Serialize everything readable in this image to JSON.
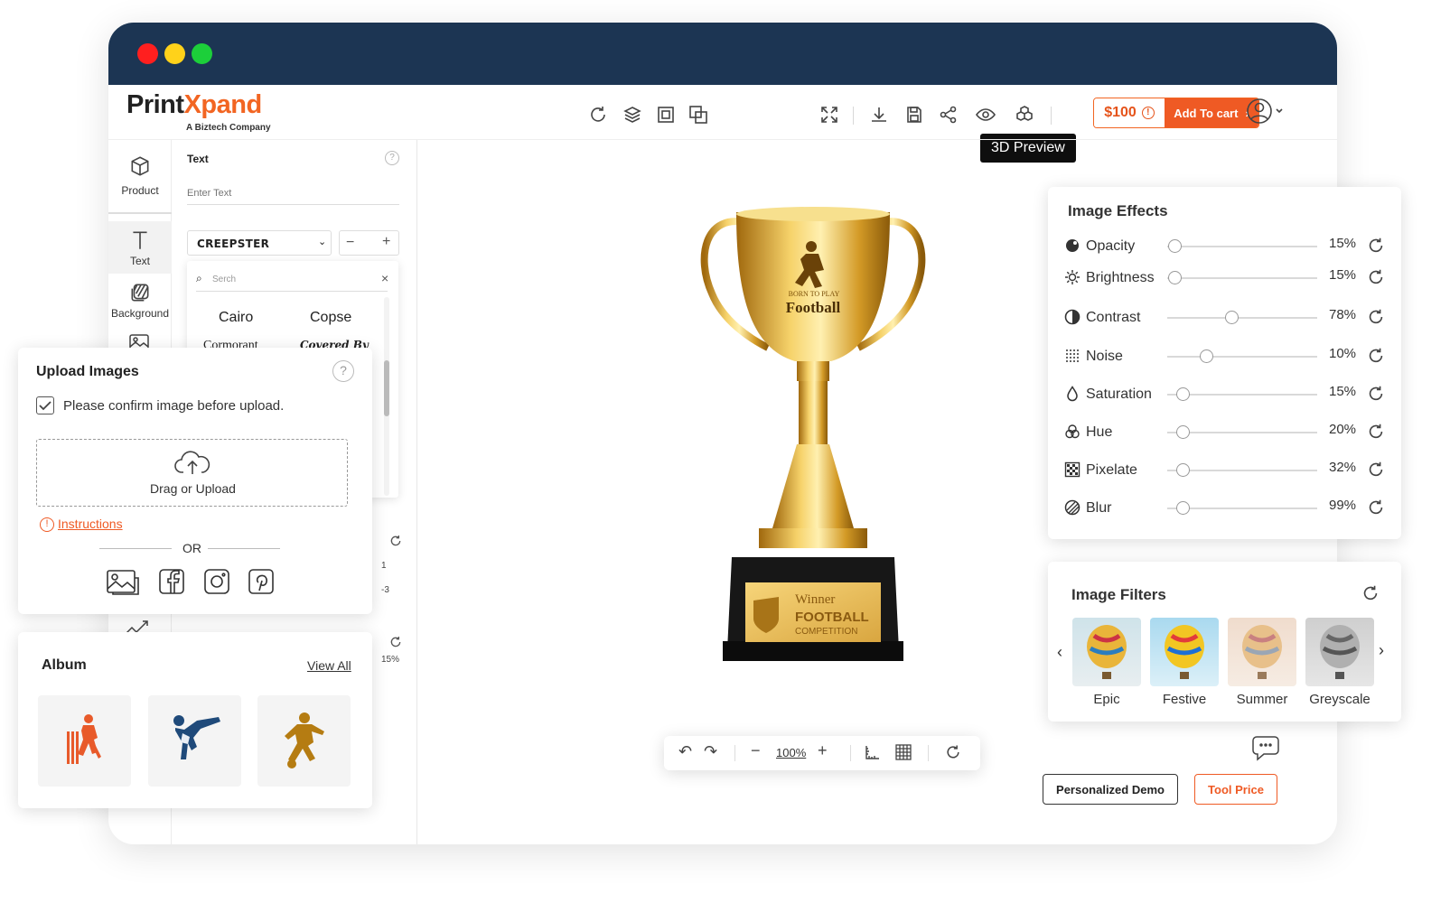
{
  "app": {
    "brand_prefix": "Print",
    "brand_x": "X",
    "brand_suffix": "pand",
    "brand_sub": "A Biztech Company"
  },
  "colors": {
    "titlebar": "#1c3553",
    "accent": "#ef5a24",
    "dot_red": "#ff1f1f",
    "dot_yellow": "#ffd21a",
    "dot_green": "#1ccf3a"
  },
  "toolbar": {
    "price": "$100",
    "add_to_cart": "Add To cart",
    "tooltip": "3D Preview",
    "icons": [
      "refresh-icon",
      "layers-icon",
      "group-icon",
      "ungroup-icon",
      "fullscreen-icon",
      "download-icon",
      "save-icon",
      "share-icon",
      "preview-eye-icon",
      "3d-preview-icon",
      "user-icon"
    ]
  },
  "rail": {
    "items": [
      {
        "label": "Product",
        "icon": "cube-icon"
      },
      {
        "label": "Text",
        "icon": "text-icon"
      },
      {
        "label": "Background",
        "icon": "background-icon"
      }
    ]
  },
  "text_panel": {
    "title": "Text",
    "placeholder": "Enter Text",
    "font_selected": "CREEPSTER",
    "search_placeholder": "Serch",
    "fonts": [
      "Cairo",
      "Copse",
      "Cormorant",
      "Covered By"
    ],
    "partial_values": [
      "1",
      "-3",
      "15%"
    ]
  },
  "upload": {
    "title": "Upload Images",
    "confirm_label": "Please confirm image before upload.",
    "drop_label": "Drag or Upload",
    "instructions": "Instructions",
    "or_label": "OR",
    "sources": [
      "gallery-icon",
      "facebook-icon",
      "instagram-icon",
      "pinterest-icon"
    ]
  },
  "album": {
    "title": "Album",
    "view_all": "View All",
    "items": [
      "cricket-player-icon",
      "karate-icon",
      "football-player-icon"
    ]
  },
  "trophy": {
    "tagline": "BORN TO PLAY",
    "sport": "Football",
    "plate_line1": "Winner",
    "plate_line2": "FOOTBALL",
    "plate_line3": "COMPETITION"
  },
  "bottom_bar": {
    "zoom": "100%"
  },
  "effects": {
    "title": "Image Effects",
    "rows": [
      {
        "label": "Opacity",
        "value": "15%",
        "level": 0.05,
        "icon": "opacity-icon"
      },
      {
        "label": "Brightness",
        "value": "15%",
        "level": 0.05,
        "icon": "brightness-icon"
      },
      {
        "label": "Contrast",
        "value": "78%",
        "level": 0.43,
        "icon": "contrast-icon"
      },
      {
        "label": "Noise",
        "value": "10%",
        "level": 0.26,
        "icon": "noise-icon"
      },
      {
        "label": "Saturation",
        "value": "15%",
        "level": 0.1,
        "icon": "saturation-icon"
      },
      {
        "label": "Hue",
        "value": "20%",
        "level": 0.1,
        "icon": "hue-icon"
      },
      {
        "label": "Pixelate",
        "value": "32%",
        "level": 0.1,
        "icon": "pixelate-icon"
      },
      {
        "label": "Blur",
        "value": "99%",
        "level": 0.1,
        "icon": "blur-icon"
      }
    ]
  },
  "filters": {
    "title": "Image Filters",
    "items": [
      "Epic",
      "Festive",
      "Summer",
      "Greyscale"
    ]
  },
  "footer": {
    "demo": "Personalized Demo",
    "tool_price": "Tool Price"
  }
}
